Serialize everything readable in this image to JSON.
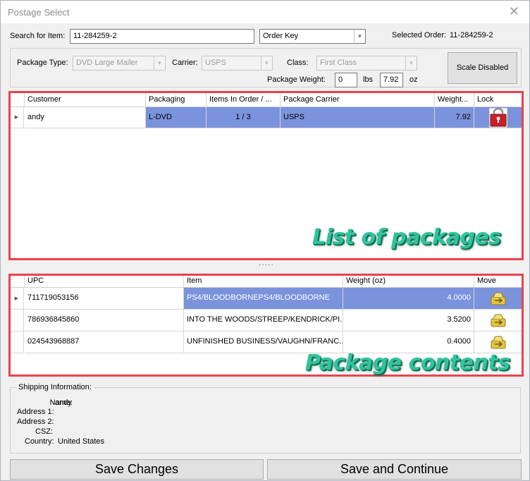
{
  "window": {
    "title": "Postage Select",
    "close_glyph": "✕"
  },
  "search": {
    "label": "Search for Item:",
    "value": "11-284259-2",
    "key_select": "Order Key"
  },
  "selected_order": {
    "label": "Selected Order:",
    "value": "11-284259-2"
  },
  "package": {
    "type_label": "Package Type:",
    "type_value": "DVD Large Mailer",
    "carrier_label": "Carrier:",
    "carrier_value": "USPS",
    "class_label": "Class:",
    "class_value": "First Class",
    "weight_label": "Package Weight:",
    "weight_lbs": "0",
    "lbs_label": "lbs",
    "weight_oz": "7.92",
    "oz_label": "oz",
    "scale_button": "Scale Disabled"
  },
  "packages_grid": {
    "columns": [
      "Customer",
      "Packaging",
      "Items In Order / ...",
      "Package Carrier",
      "Weight...",
      "Lock"
    ],
    "rows": [
      {
        "customer": "andy",
        "packaging": "L-DVD",
        "items": "1 / 3",
        "carrier": "USPS",
        "weight": "7.92",
        "lock_icon": "lock-icon"
      }
    ]
  },
  "splitter": "·····",
  "contents_grid": {
    "columns": [
      "UPC",
      "Item",
      "Weight (oz)",
      "Move"
    ],
    "rows": [
      {
        "upc": "711719053156",
        "item": "PS4/BLOODBORNEPS4/BLOODBORNE",
        "weight": "4.0000",
        "move_icon": "move-icon"
      },
      {
        "upc": "786936845860",
        "item": "INTO THE WOODS/STREEP/KENDRICK/PI...",
        "weight": "3.5200",
        "move_icon": "move-icon"
      },
      {
        "upc": "024543968887",
        "item": "UNFINISHED BUSINESS/VAUGHN/FRANC...",
        "weight": "0.4000",
        "move_icon": "move-icon"
      }
    ]
  },
  "callouts": {
    "packages": "List of packages",
    "contents": "Package contents"
  },
  "shipping": {
    "legend": "Shipping Information:",
    "name_label": "Name:",
    "name": "andy",
    "address1_label": "Address 1:",
    "address1": "",
    "address2_label": "Address 2:",
    "address2": "",
    "csz_label": "CSZ:",
    "csz": "",
    "country_label": "Country:",
    "country": "United States"
  },
  "buttons": {
    "save_changes": "Save Changes",
    "save_continue": "Save and Continue"
  },
  "colors": {
    "selection": "#7b93dc",
    "callout": "#2fc49c",
    "highlight_box": "#e8434f"
  }
}
